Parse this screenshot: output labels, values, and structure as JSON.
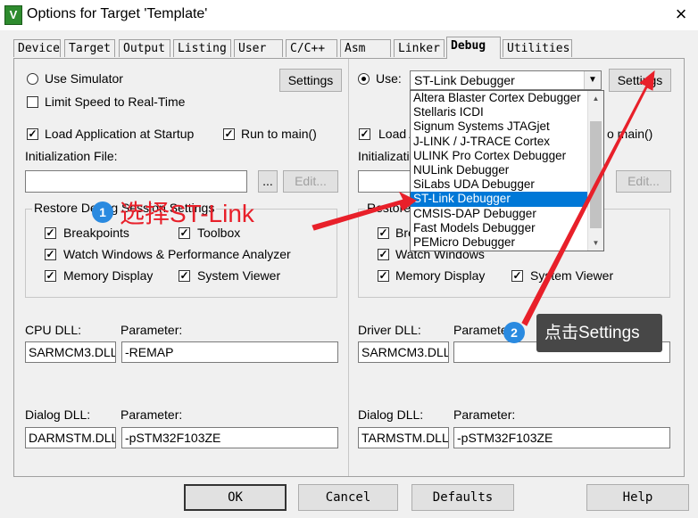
{
  "window": {
    "title": "Options for Target 'Template'",
    "close": "×",
    "app_icon_letter": "V"
  },
  "tabs": [
    "Device",
    "Target",
    "Output",
    "Listing",
    "User",
    "C/C++",
    "Asm",
    "Linker",
    "Debug",
    "Utilities"
  ],
  "active_tab": "Debug",
  "left": {
    "use_simulator": "Use Simulator",
    "settings": "Settings",
    "limit_speed": "Limit Speed to Real-Time",
    "load_app": "Load Application at Startup",
    "run_to_main": "Run to main()",
    "init_file_label": "Initialization File:",
    "init_file_value": "",
    "browse": "...",
    "edit": "Edit...",
    "restore_group": "Restore Debug Session Settings",
    "breakpoints": "Breakpoints",
    "toolbox": "Toolbox",
    "watch_windows": "Watch Windows & Performance Analyzer",
    "memory_display": "Memory Display",
    "system_viewer": "System Viewer",
    "cpu_dll_label": "CPU DLL:",
    "cpu_dll_value": "SARMCM3.DLL",
    "cpu_param_label": "Parameter:",
    "cpu_param_value": "-REMAP",
    "dialog_dll_label": "Dialog DLL:",
    "dialog_dll_value": "DARMSTM.DLL",
    "dialog_param_label": "Parameter:",
    "dialog_param_value": "-pSTM32F103ZE"
  },
  "right": {
    "use_label": "Use:",
    "debugger_selected": "ST-Link Debugger",
    "settings": "Settings",
    "load_app_partial": "Load A",
    "run_to_main_partial": "o main()",
    "init_label_partial": "Initializatio",
    "edit": "Edit...",
    "restore_partial": "Restore",
    "breakpoints_partial": "Brea",
    "watch_windows": "Watch Windows",
    "memory_display": "Memory Display",
    "system_viewer": "System Viewer",
    "driver_dll_label": "Driver DLL:",
    "driver_dll_value": "SARMCM3.DLL",
    "driver_param_label": "Parameter:",
    "driver_param_value": "",
    "dialog_dll_label": "Dialog DLL:",
    "dialog_dll_value": "TARMSTM.DLL",
    "dialog_param_label": "Parameter:",
    "dialog_param_value": "-pSTM32F103ZE"
  },
  "dropdown_items": [
    "Altera Blaster Cortex Debugger",
    "Stellaris ICDI",
    "Signum Systems JTAGjet",
    "J-LINK / J-TRACE Cortex",
    "ULINK Pro Cortex Debugger",
    "NULink Debugger",
    "SiLabs UDA Debugger",
    "ST-Link Debugger",
    "CMSIS-DAP Debugger",
    "Fast Models Debugger",
    "PEMicro Debugger"
  ],
  "dropdown_selected_index": 7,
  "annotations": {
    "step1_num": "1",
    "step1_text": "选择ST-Link",
    "step2_num": "2",
    "step2_text": "点击Settings",
    "arrow_color": "#e8202a"
  },
  "buttons": {
    "ok": "OK",
    "cancel": "Cancel",
    "defaults": "Defaults",
    "help": "Help"
  }
}
